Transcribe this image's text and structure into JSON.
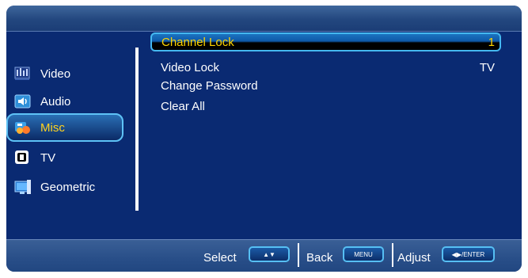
{
  "sidebar": {
    "items": [
      {
        "label": "Video"
      },
      {
        "label": "Audio"
      },
      {
        "label": "Misc"
      },
      {
        "label": "TV"
      },
      {
        "label": "Geometric"
      }
    ],
    "active": "Misc"
  },
  "menu": {
    "items": [
      {
        "label": "Channel Lock",
        "value": "1"
      },
      {
        "label": "Video Lock",
        "value": "TV"
      },
      {
        "label": "Change Password",
        "value": ""
      },
      {
        "label": "Clear All",
        "value": ""
      }
    ],
    "selected": "Channel Lock"
  },
  "footer": {
    "select_label": "Select",
    "select_key": "▲▼",
    "back_label": "Back",
    "back_key": "MENU",
    "adjust_label": "Adjust",
    "adjust_key": "◀▶/ENTER"
  },
  "colors": {
    "panel_bg": "#0a2a72",
    "highlight_text": "#ffd400",
    "accent_border": "#45b8f0"
  },
  "icons": {
    "video": "video-icon",
    "audio": "audio-icon",
    "misc": "misc-icon",
    "tv": "tv-icon",
    "geometric": "geometric-icon"
  }
}
